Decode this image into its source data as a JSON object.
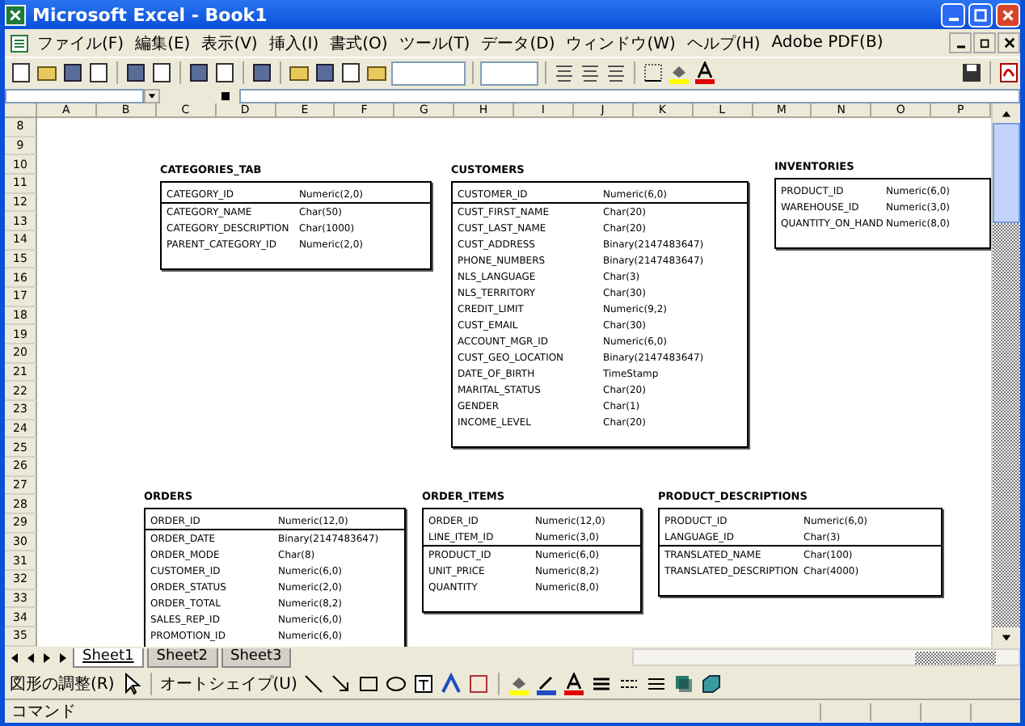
{
  "window": {
    "title": "Microsoft Excel - Book1"
  },
  "menu": [
    "ファイル(F)",
    "編集(E)",
    "表示(V)",
    "挿入(I)",
    "書式(O)",
    "ツール(T)",
    "データ(D)",
    "ウィンドウ(W)",
    "ヘルプ(H)",
    "Adobe PDF(B)"
  ],
  "sheet": {
    "columns": [
      "A",
      "B",
      "C",
      "D",
      "E",
      "F",
      "G",
      "H",
      "I",
      "J",
      "K",
      "L",
      "M",
      "N",
      "O",
      "P"
    ],
    "rows": [
      "8",
      "9",
      "10",
      "11",
      "12",
      "13",
      "14",
      "15",
      "16",
      "17",
      "18",
      "19",
      "20",
      "21",
      "22",
      "23",
      "24",
      "25",
      "26",
      "27",
      "28",
      "29",
      "30",
      "31",
      "32",
      "33",
      "34",
      "35"
    ],
    "tables": [
      {
        "name": "CATEGORIES_TAB",
        "key_fields": [
          {
            "name": "CATEGORY_ID",
            "type": "Numeric(2,0)"
          }
        ],
        "fields": [
          {
            "name": "CATEGORY_NAME",
            "type": "Char(50)"
          },
          {
            "name": "CATEGORY_DESCRIPTION",
            "type": "Char(1000)"
          },
          {
            "name": "PARENT_CATEGORY_ID",
            "type": "Numeric(2,0)"
          }
        ]
      },
      {
        "name": "CUSTOMERS",
        "key_fields": [
          {
            "name": "CUSTOMER_ID",
            "type": "Numeric(6,0)"
          }
        ],
        "fields": [
          {
            "name": "CUST_FIRST_NAME",
            "type": "Char(20)"
          },
          {
            "name": "CUST_LAST_NAME",
            "type": "Char(20)"
          },
          {
            "name": "CUST_ADDRESS",
            "type": "Binary(2147483647)"
          },
          {
            "name": "PHONE_NUMBERS",
            "type": "Binary(2147483647)"
          },
          {
            "name": "NLS_LANGUAGE",
            "type": "Char(3)"
          },
          {
            "name": "NLS_TERRITORY",
            "type": "Char(30)"
          },
          {
            "name": "CREDIT_LIMIT",
            "type": "Numeric(9,2)"
          },
          {
            "name": "CUST_EMAIL",
            "type": "Char(30)"
          },
          {
            "name": "ACCOUNT_MGR_ID",
            "type": "Numeric(6,0)"
          },
          {
            "name": "CUST_GEO_LOCATION",
            "type": "Binary(2147483647)"
          },
          {
            "name": "DATE_OF_BIRTH",
            "type": "TimeStamp"
          },
          {
            "name": "MARITAL_STATUS",
            "type": "Char(20)"
          },
          {
            "name": "GENDER",
            "type": "Char(1)"
          },
          {
            "name": "INCOME_LEVEL",
            "type": "Char(20)"
          }
        ]
      },
      {
        "name": "INVENTORIES",
        "fields": [
          {
            "name": "PRODUCT_ID",
            "type": "Numeric(6,0)"
          },
          {
            "name": "WAREHOUSE_ID",
            "type": "Numeric(3,0)"
          },
          {
            "name": "QUANTITY_ON_HAND",
            "type": "Numeric(8,0)"
          }
        ]
      },
      {
        "name": "ORDERS",
        "key_fields": [
          {
            "name": "ORDER_ID",
            "type": "Numeric(12,0)"
          }
        ],
        "fields": [
          {
            "name": "ORDER_DATE",
            "type": "Binary(2147483647)"
          },
          {
            "name": "ORDER_MODE",
            "type": "Char(8)"
          },
          {
            "name": "CUSTOMER_ID",
            "type": "Numeric(6,0)"
          },
          {
            "name": "ORDER_STATUS",
            "type": "Numeric(2,0)"
          },
          {
            "name": "ORDER_TOTAL",
            "type": "Numeric(8,2)"
          },
          {
            "name": "SALES_REP_ID",
            "type": "Numeric(6,0)"
          },
          {
            "name": "PROMOTION_ID",
            "type": "Numeric(6,0)"
          }
        ]
      },
      {
        "name": "ORDER_ITEMS",
        "key_fields": [
          {
            "name": "ORDER_ID",
            "type": "Numeric(12,0)"
          },
          {
            "name": "LINE_ITEM_ID",
            "type": "Numeric(3,0)"
          }
        ],
        "fields": [
          {
            "name": "PRODUCT_ID",
            "type": "Numeric(6,0)"
          },
          {
            "name": "UNIT_PRICE",
            "type": "Numeric(8,2)"
          },
          {
            "name": "QUANTITY",
            "type": "Numeric(8,0)"
          }
        ]
      },
      {
        "name": "PRODUCT_DESCRIPTIONS",
        "key_fields": [
          {
            "name": "PRODUCT_ID",
            "type": "Numeric(6,0)"
          },
          {
            "name": "LANGUAGE_ID",
            "type": "Char(3)"
          }
        ],
        "fields": [
          {
            "name": "TRANSLATED_NAME",
            "type": "Char(100)"
          },
          {
            "name": "TRANSLATED_DESCRIPTION",
            "type": "Char(4000)"
          }
        ]
      }
    ]
  },
  "sheet_tabs": [
    {
      "label": "Sheet1",
      "selected": true
    },
    {
      "label": "Sheet2",
      "selected": false
    },
    {
      "label": "Sheet3",
      "selected": false
    }
  ],
  "drawing_toolbar": {
    "draw_menu": "図形の調整(R)",
    "autoshape_menu": "オートシェイプ(U)"
  },
  "status_bar": {
    "text": "コマンド"
  }
}
